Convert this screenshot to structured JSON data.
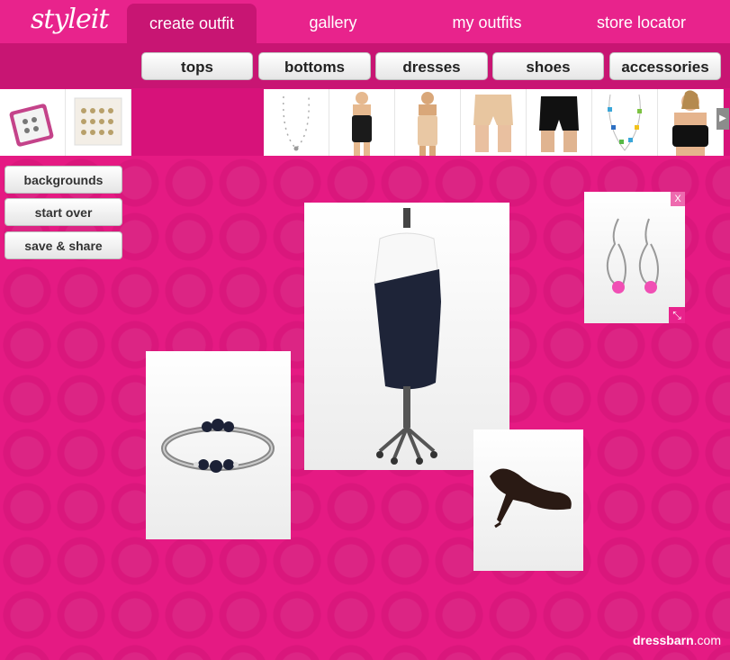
{
  "header": {
    "logo": "styleit",
    "tabs": [
      {
        "label": "create outfit",
        "active": true
      },
      {
        "label": "gallery"
      },
      {
        "label": "my outfits"
      },
      {
        "label": "store locator"
      }
    ]
  },
  "categories": [
    "tops",
    "bottoms",
    "dresses",
    "shoes",
    "accessories"
  ],
  "strip": {
    "left_arrow": "◀",
    "right_arrow": "▶",
    "items": [
      "earring-set",
      "jewelry-card",
      "necklace",
      "shapewear-bodysuit",
      "shapewear-dress",
      "nude-shorts",
      "black-shorts",
      "beaded-necklace",
      "sports-bra"
    ]
  },
  "sidebar": {
    "backgrounds": "backgrounds",
    "start_over": "start over",
    "save_share": "save & share"
  },
  "canvas": {
    "items": [
      "bracelet",
      "dress",
      "earrings",
      "heels"
    ],
    "close_label": "X",
    "resize_label": "⤡"
  },
  "footer": {
    "brand_bold": "dressbarn",
    "brand_suffix": ".com"
  },
  "colors": {
    "accent": "#e8238c",
    "dark_accent": "#c81573",
    "background": "#e51a83"
  }
}
